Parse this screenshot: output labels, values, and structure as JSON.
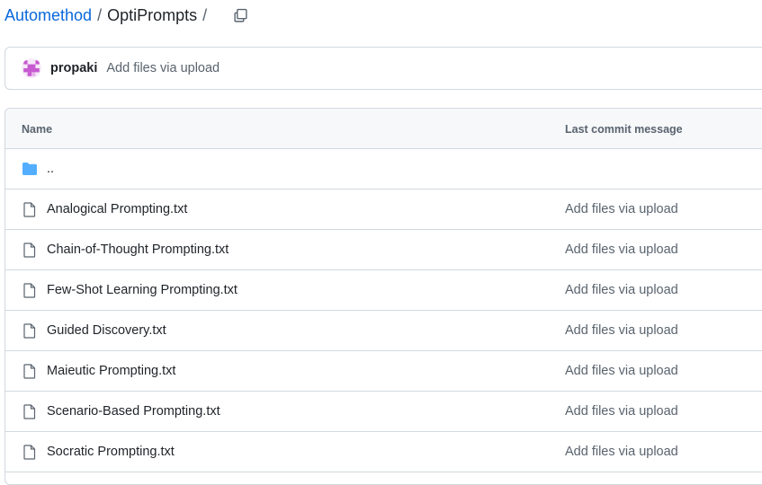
{
  "breadcrumb": {
    "owner": "Automethod",
    "repo": "OptiPrompts",
    "separator": "/"
  },
  "commit": {
    "author": "propaki",
    "message": "Add files via upload"
  },
  "table": {
    "headers": {
      "name": "Name",
      "last_commit": "Last commit message"
    },
    "parent_dir": "..",
    "files": [
      {
        "name": "Analogical Prompting.txt",
        "message": "Add files via upload"
      },
      {
        "name": "Chain-of-Thought Prompting.txt",
        "message": "Add files via upload"
      },
      {
        "name": "Few-Shot Learning Prompting.txt",
        "message": "Add files via upload"
      },
      {
        "name": "Guided Discovery.txt",
        "message": "Add files via upload"
      },
      {
        "name": "Maieutic Prompting.txt",
        "message": "Add files via upload"
      },
      {
        "name": "Scenario-Based Prompting.txt",
        "message": "Add files via upload"
      },
      {
        "name": "Socratic Prompting.txt",
        "message": "Add files via upload"
      }
    ]
  },
  "icons": {
    "folder": "folder-icon",
    "file": "file-icon",
    "copy": "copy-icon"
  },
  "colors": {
    "link": "#0969da",
    "folder": "#54aeff",
    "muted": "#59636e",
    "border": "#d1d9e0",
    "header_bg": "#f6f8fa",
    "avatar": "#c75ad1"
  }
}
